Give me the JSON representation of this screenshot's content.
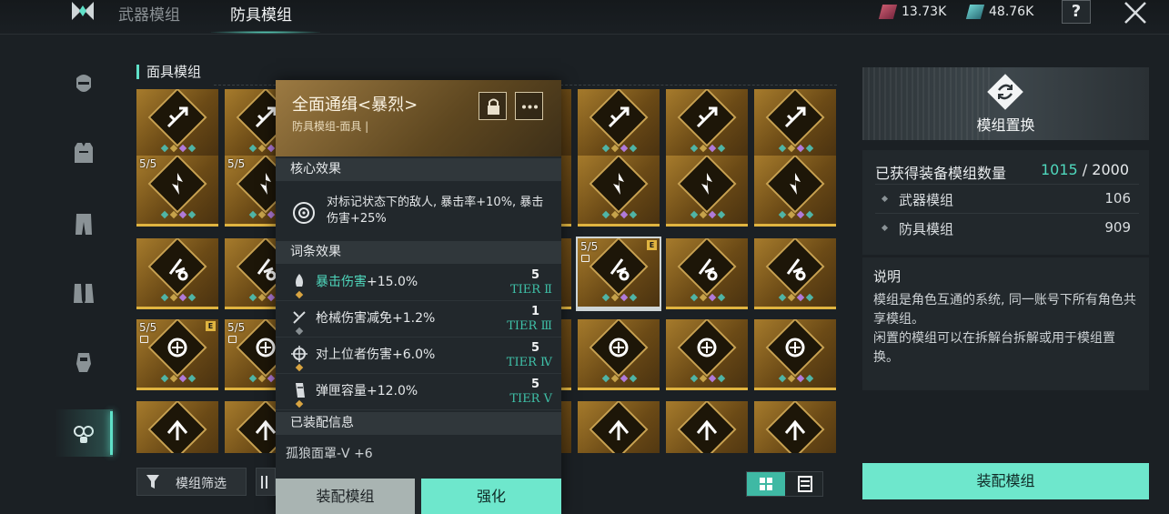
{
  "header": {
    "tabs": [
      {
        "label": "武器模组"
      },
      {
        "label": "防具模组"
      }
    ],
    "currency": [
      {
        "icon": "red-crystal-icon",
        "value": "13.73K"
      },
      {
        "icon": "teal-crystal-icon",
        "value": "48.76K"
      }
    ],
    "help_label": "?"
  },
  "rail": {
    "items": [
      "mask-icon",
      "vest-icon",
      "pants-icon",
      "boots-icon",
      "gloves-icon",
      "gasmask-icon"
    ],
    "active": "gasmask-icon"
  },
  "section": {
    "title": "面具模组"
  },
  "grid": {
    "cells": [
      {
        "count": "",
        "lock": false,
        "badge": ""
      },
      {
        "count": "",
        "lock": false,
        "badge": ""
      },
      {
        "count": "",
        "lock": false,
        "badge": ""
      },
      {
        "count": "",
        "lock": false,
        "badge": ""
      },
      {
        "count": "",
        "lock": false,
        "badge": ""
      },
      {
        "count": "",
        "lock": false,
        "badge": ""
      },
      {
        "count": "",
        "lock": false,
        "badge": ""
      },
      {
        "count": "",
        "lock": false,
        "badge": ""
      },
      {
        "count": "5/5",
        "lock": false,
        "badge": ""
      },
      {
        "count": "5/5",
        "lock": false,
        "badge": ""
      },
      {
        "count": "",
        "lock": false,
        "badge": ""
      },
      {
        "count": "",
        "lock": false,
        "badge": ""
      },
      {
        "count": "",
        "lock": false,
        "badge": ""
      },
      {
        "count": "",
        "lock": false,
        "badge": ""
      },
      {
        "count": "",
        "lock": false,
        "badge": ""
      },
      {
        "count": "",
        "lock": false,
        "badge": ""
      },
      {
        "count": "",
        "lock": false,
        "badge": ""
      },
      {
        "count": "",
        "lock": false,
        "badge": ""
      },
      {
        "count": "",
        "lock": false,
        "badge": ""
      },
      {
        "count": "",
        "lock": false,
        "badge": ""
      },
      {
        "count": "",
        "lock": false,
        "badge": ""
      },
      {
        "count": "5/5",
        "lock": true,
        "badge": "E"
      },
      {
        "count": "",
        "lock": false,
        "badge": ""
      },
      {
        "count": "",
        "lock": false,
        "badge": ""
      },
      {
        "count": "5/5",
        "lock": true,
        "badge": "E"
      },
      {
        "count": "5/5",
        "lock": true,
        "badge": "E"
      },
      {
        "count": "",
        "lock": false,
        "badge": ""
      },
      {
        "count": "",
        "lock": false,
        "badge": ""
      },
      {
        "count": "",
        "lock": false,
        "badge": ""
      },
      {
        "count": "",
        "lock": false,
        "badge": ""
      },
      {
        "count": "",
        "lock": false,
        "badge": ""
      },
      {
        "count": "",
        "lock": false,
        "badge": ""
      },
      {
        "count": "",
        "lock": false,
        "badge": ""
      },
      {
        "count": "",
        "lock": false,
        "badge": ""
      },
      {
        "count": "",
        "lock": false,
        "badge": ""
      },
      {
        "count": "",
        "lock": false,
        "badge": ""
      },
      {
        "count": "",
        "lock": false,
        "badge": ""
      },
      {
        "count": "",
        "lock": false,
        "badge": ""
      },
      {
        "count": "",
        "lock": false,
        "badge": ""
      },
      {
        "count": "",
        "lock": false,
        "badge": ""
      }
    ]
  },
  "popup": {
    "title": "全面通缉<暴烈>",
    "subtitle": "防具模组-面具 |",
    "core_header": "核心效果",
    "core_text": "对标记状态下的敌人, 暴击率+10%, 暴击伤害+25%",
    "affix_header": "词条效果",
    "affixes": [
      {
        "icon": "flame-icon",
        "name": "暴击伤害",
        "value": "+15.0%",
        "level": "5",
        "tier": "TIER Ⅱ",
        "highlight": true,
        "dot": "gold"
      },
      {
        "icon": "blade-icon",
        "name": "枪械伤害减免",
        "value": "+1.2%",
        "level": "1",
        "tier": "TIER Ⅲ",
        "highlight": false,
        "dot": "grey"
      },
      {
        "icon": "target-icon",
        "name": "对上位者伤害",
        "value": "+6.0%",
        "level": "5",
        "tier": "TIER Ⅳ",
        "highlight": false,
        "dot": "gold"
      },
      {
        "icon": "magazine-icon",
        "name": "弹匣容量",
        "value": "+12.0%",
        "level": "5",
        "tier": "TIER Ⅴ",
        "highlight": false,
        "dot": "gold"
      }
    ],
    "equip_header": "已装配信息",
    "equip_info": "孤狼面罩-Ⅴ +6",
    "equip_btn": "装配模组",
    "enhance_btn": "强化"
  },
  "controls": {
    "filter_label": "模组筛选"
  },
  "right": {
    "banner_title": "模组置换",
    "stat_label": "已获得装备模组数量",
    "stat_current": "1015",
    "stat_total": " / 2000",
    "rows": [
      {
        "label": "武器模组",
        "value": "106"
      },
      {
        "label": "防具模组",
        "value": "909"
      }
    ],
    "desc_title": "说明",
    "desc_lines": [
      "模组是角色互通的系统, 同一账号下所有角色共享模组。",
      "闲置的模组可以在拆解台拆解或用于模组置换。"
    ],
    "main_btn": "装配模组"
  },
  "colors": {
    "accent": "#6ee7cc",
    "gold": "#e0b440",
    "bg": "#1b2024"
  }
}
